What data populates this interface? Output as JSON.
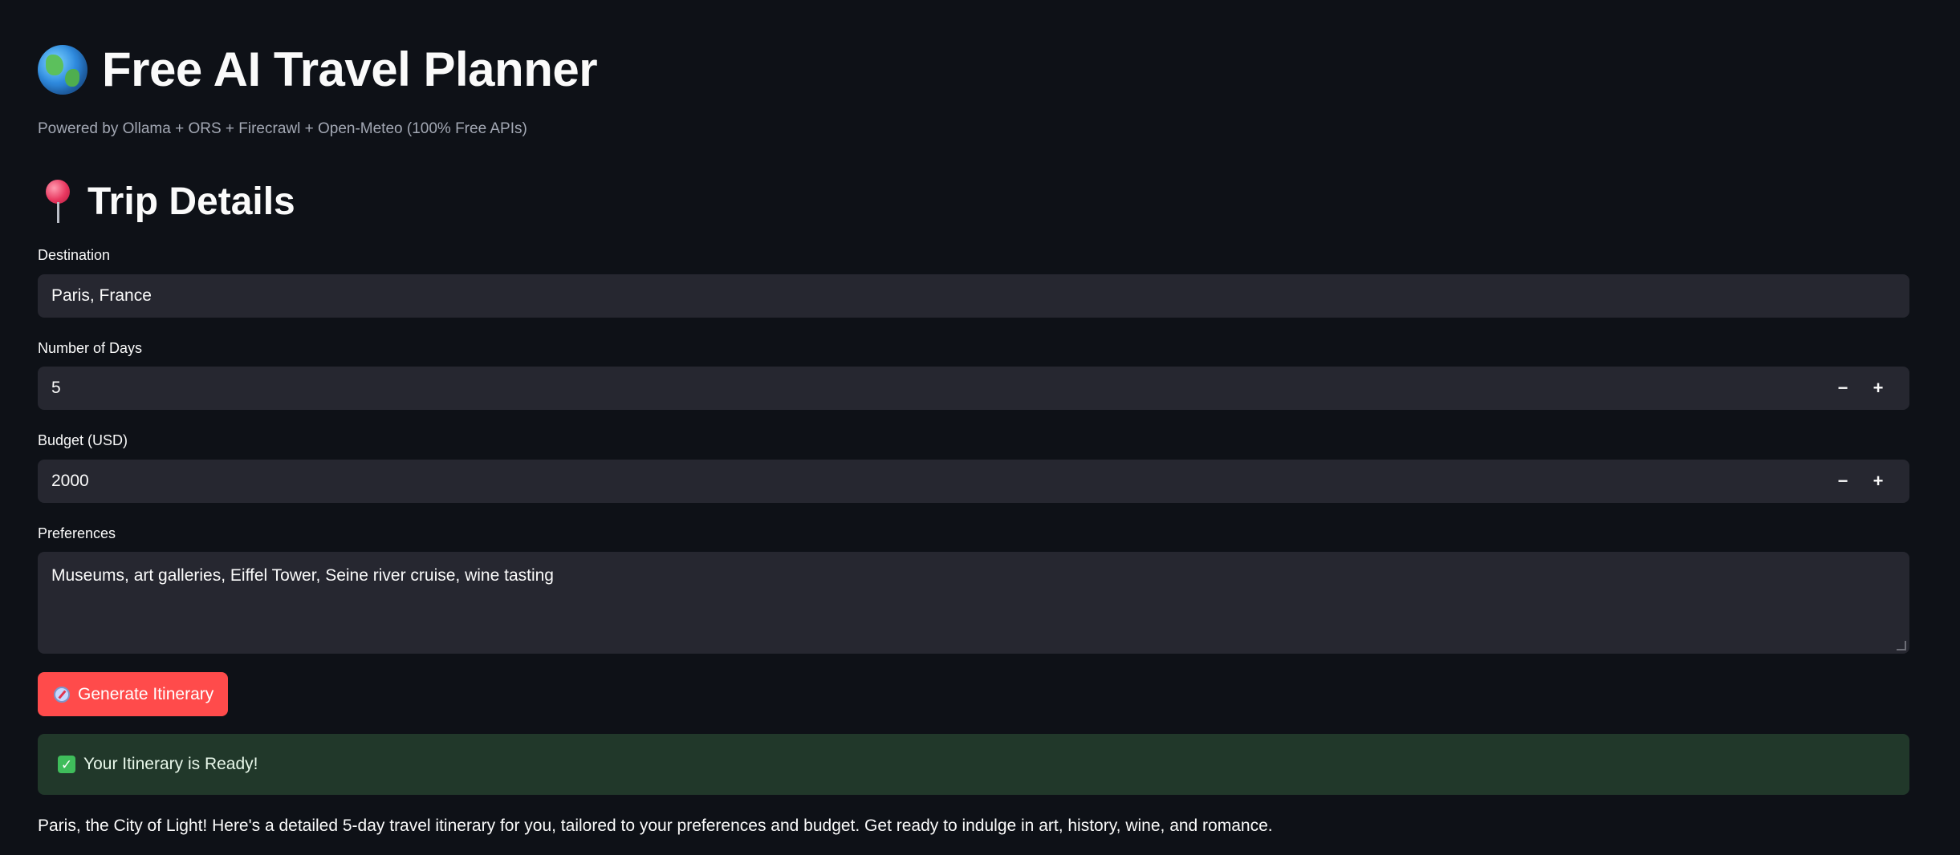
{
  "header": {
    "title": "Free AI Travel Planner",
    "title_icon": "globe-icon",
    "subtitle": "Powered by Ollama + ORS + Firecrawl + Open-Meteo (100% Free APIs)"
  },
  "section": {
    "title": "Trip Details",
    "icon": "pin-icon"
  },
  "form": {
    "destination": {
      "label": "Destination",
      "value": "Paris, France"
    },
    "days": {
      "label": "Number of Days",
      "value": "5",
      "decrement": "−",
      "increment": "+"
    },
    "budget": {
      "label": "Budget (USD)",
      "value": "2000",
      "decrement": "−",
      "increment": "+"
    },
    "preferences": {
      "label": "Preferences",
      "value": "Museums, art galleries, Eiffel Tower, Seine river cruise, wine tasting"
    }
  },
  "generate_button": {
    "label": "Generate Itinerary",
    "icon": "compass-icon"
  },
  "status": {
    "message": "Your Itinerary is Ready!",
    "icon": "check-icon",
    "check_glyph": "✓"
  },
  "result": {
    "intro": "Paris, the City of Light! Here's a detailed 5-day travel itinerary for you, tailored to your preferences and budget. Get ready to indulge in art, history, wine, and romance."
  },
  "colors": {
    "background": "#0e1117",
    "input_background": "#262730",
    "primary_button": "#ff4b4b",
    "success_background": "#21382a"
  }
}
